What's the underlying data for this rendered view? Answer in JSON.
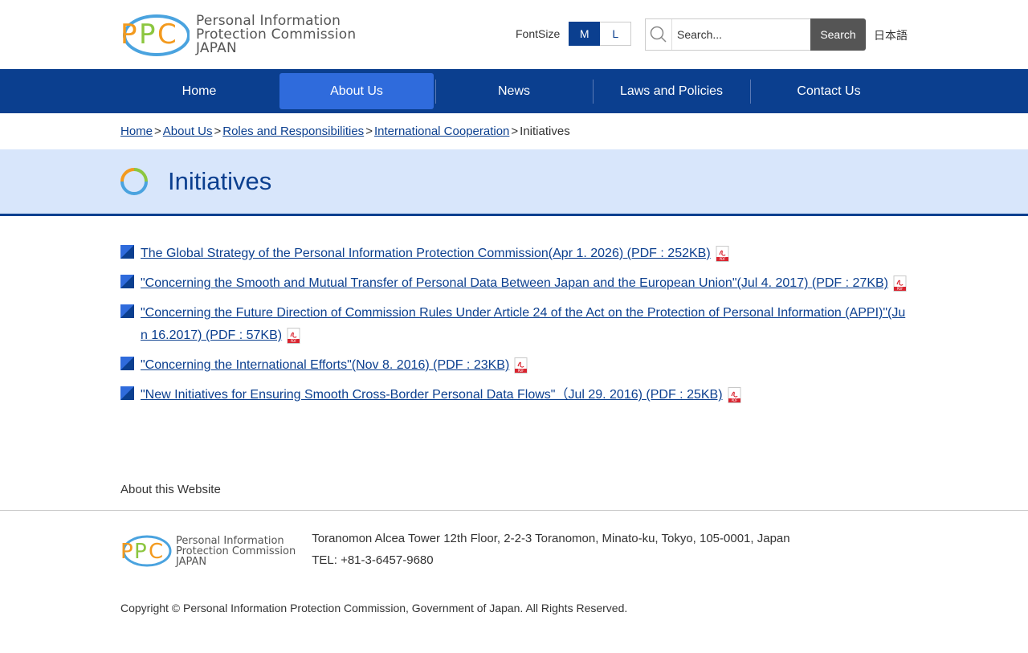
{
  "header": {
    "logo_letters": "PPC",
    "logo_lines": [
      "Personal Information",
      "Protection Commission",
      "JAPAN"
    ],
    "fontsize_label": "FontSize",
    "fontsize_options": [
      "M",
      "L"
    ],
    "search_placeholder": "Search...",
    "search_button": "Search",
    "language_link": "日本語"
  },
  "nav": {
    "items": [
      "Home",
      "About Us",
      "News",
      "Laws and Policies",
      "Contact Us"
    ],
    "active": "About Us"
  },
  "breadcrumb": {
    "items": [
      "Home",
      "About Us",
      "Roles and Responsibilities",
      "International Cooperation"
    ],
    "current": "Initiatives",
    "separator": ">"
  },
  "page": {
    "title": "Initiatives"
  },
  "documents": [
    {
      "label": "The Global Strategy of the Personal Information Protection Commission(Apr 1. 2026) (PDF : 252KB)"
    },
    {
      "label": "\"Concerning the Smooth and Mutual Transfer of Personal Data Between Japan and the European Union\"(Jul 4. 2017) (PDF : 27KB)"
    },
    {
      "label": "\"Concerning the Future Direction of Commission Rules Under Article 24 of the Act on the Protection of Personal Information (APPI)\"(Jun 16.2017) (PDF : 57KB)"
    },
    {
      "label": "\"Concerning the International Efforts\"(Nov 8. 2016) (PDF : 23KB)"
    },
    {
      "label": "\"New Initiatives for Ensuring Smooth Cross-Border Personal Data Flows\"（Jul 29. 2016) (PDF : 25KB)"
    }
  ],
  "pdf_icon_text": "PDF",
  "footer": {
    "about_link": "About this Website",
    "address": "Toranomon Alcea Tower 12th Floor, 2-2-3 Toranomon, Minato-ku, Tokyo, 105-0001, Japan",
    "tel": "TEL: +81-3-6457-9680",
    "copyright": "Copyright © Personal Information Protection Commission, Government of Japan. All Rights Reserved."
  },
  "colors": {
    "brand_blue": "#0b3f8f",
    "active_nav": "#2f6bdc",
    "title_band": "#d8e6fb",
    "logo_orange": "#f39a1e",
    "logo_green": "#8cc63f",
    "logo_blue": "#4aa3df"
  }
}
